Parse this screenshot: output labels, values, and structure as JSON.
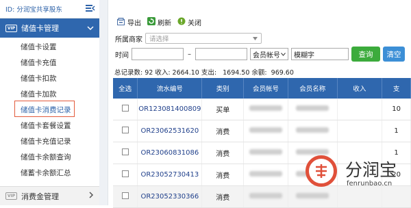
{
  "sidebar": {
    "id_label": "ID: 分润宝共享股东",
    "group_title": "储值卡管理",
    "items": [
      {
        "label": "储值卡设置"
      },
      {
        "label": "储值卡充值"
      },
      {
        "label": "储值卡扣款"
      },
      {
        "label": "储值卡加款"
      },
      {
        "label": "储值卡消费记录"
      },
      {
        "label": "储值卡套餐设置"
      },
      {
        "label": "储值卡充值记录"
      },
      {
        "label": "储值卡余额查询"
      },
      {
        "label": "储蓄卡余额汇总"
      }
    ],
    "bottom_group_title": "消费金管理"
  },
  "toolbar": {
    "export_label": "导出",
    "refresh_label": "刷新",
    "close_label": "关闭"
  },
  "filters": {
    "merchant_label": "所属商家",
    "merchant_placeholder": "请选择",
    "time_label": "时间",
    "dash": "–",
    "member_select": "会员帐号",
    "fuzzy_value": "模糊字",
    "query_label": "查询",
    "clear_label": "清空"
  },
  "summary": "总记录数: 92 收入: 2664.10 支出:   1694.50 余额:  969.60",
  "table": {
    "headers": [
      "全选",
      "流水编号",
      "类别",
      "会员帐号",
      "会员名称",
      "收入",
      "支"
    ],
    "rows": [
      {
        "serial": "OR123081400809",
        "type": "买单",
        "income": "",
        "extra": "10"
      },
      {
        "serial": "OR23062531620",
        "type": "消费",
        "income": "",
        "extra": "1"
      },
      {
        "serial": "OR23060831086",
        "type": "消费",
        "income": "",
        "extra": "1"
      },
      {
        "serial": "OR23052730413",
        "type": "消费",
        "income": "",
        "extra": "20"
      },
      {
        "serial": "OR23052330366",
        "type": "消费",
        "income": "",
        "extra": ""
      }
    ]
  },
  "watermark": {
    "brand": "分润宝",
    "domain": "fenrunbao.cn"
  },
  "colors": {
    "accent": "#2f67ae",
    "query_green": "#3cab3c",
    "clear_blue": "#3c8fd6",
    "highlight_red": "#e25a3b"
  }
}
